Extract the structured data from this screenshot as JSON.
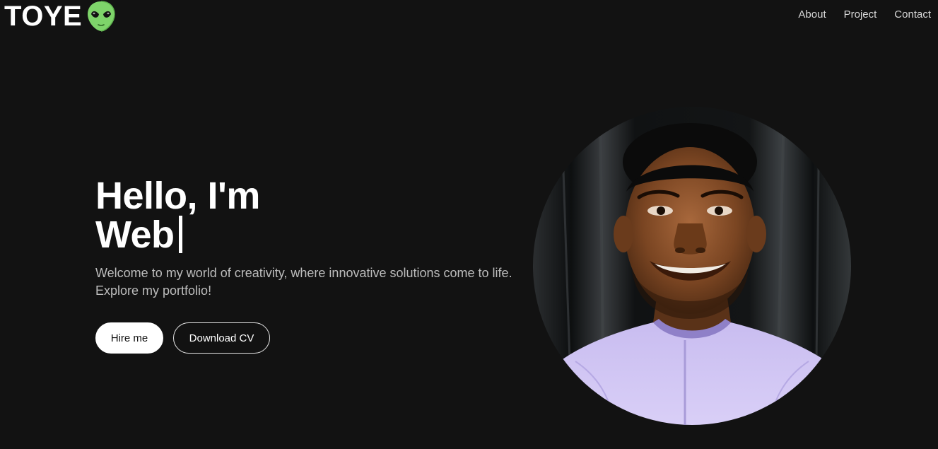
{
  "brand": {
    "name": "TOYE",
    "icon": "alien-icon"
  },
  "nav": {
    "items": [
      {
        "label": "About"
      },
      {
        "label": "Project"
      },
      {
        "label": "Contact"
      }
    ]
  },
  "hero": {
    "greeting": "Hello, I'm",
    "role_typed": "Web",
    "subtitle": "Welcome to my world of creativity, where innovative solutions come to life. Explore my portfolio!",
    "buttons": {
      "hire_label": "Hire me",
      "cv_label": "Download CV"
    }
  },
  "portrait": {
    "alt": "profile photo"
  },
  "colors": {
    "background": "#121212",
    "text": "#ffffff",
    "muted_text": "#bdbdbd",
    "alien_green": "#7ed46a"
  }
}
